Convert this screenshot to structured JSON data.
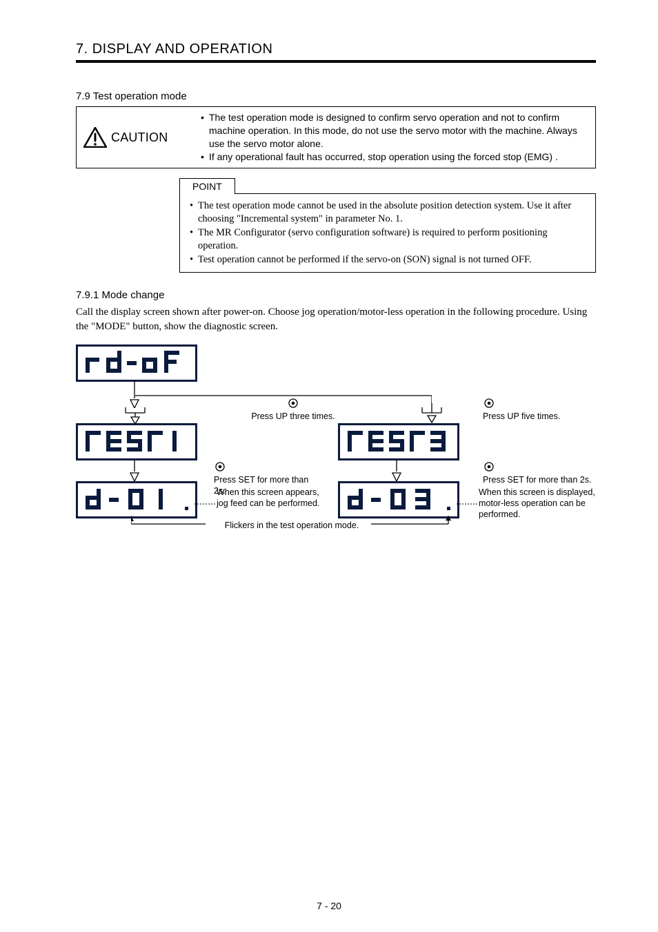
{
  "header": {
    "title": "7. DISPLAY AND OPERATION"
  },
  "sec79": {
    "heading": "7.9 Test operation mode"
  },
  "caution": {
    "label": "CAUTION",
    "bullet1": "The test operation mode is designed to confirm servo operation and not to confirm machine operation. In this mode, do not use the servo motor with the machine. Always use the servo motor alone.",
    "bullet2": "If any operational fault has occurred, stop operation using the forced stop (EMG) ."
  },
  "point": {
    "label": "POINT",
    "b1": "The test operation mode cannot be used in the absolute position detection system. Use it after choosing \"Incremental system\" in parameter No. 1.",
    "b2": "The MR Configurator (servo configuration software) is required to perform positioning operation.",
    "b3": "Test operation cannot be performed if the servo-on (SON) signal is not turned OFF."
  },
  "sec791": {
    "heading": "7.9.1 Mode change",
    "para": "Call the display screen shown after power-on. Choose jog operation/motor-less operation in the following procedure. Using the \"MODE\" button, show the diagnostic screen."
  },
  "diagram": {
    "seg_top": "rd-oF",
    "seg_left_mid": "TEST1",
    "seg_left_bot": "d-01",
    "seg_right_mid": "TEST3",
    "seg_right_bot": "d-03",
    "press_up3": "Press UP three times.",
    "press_up5": "Press UP five times.",
    "press_set_left": "Press SET for more than 2s.",
    "press_set_right": "Press SET for more than 2s.",
    "note_left": "When this screen appears, jog feed can be performed.",
    "note_right": "When this screen is displayed, motor-less operation can be performed.",
    "flicker": "Flickers in the test operation mode."
  },
  "page_number": "7 -  20"
}
